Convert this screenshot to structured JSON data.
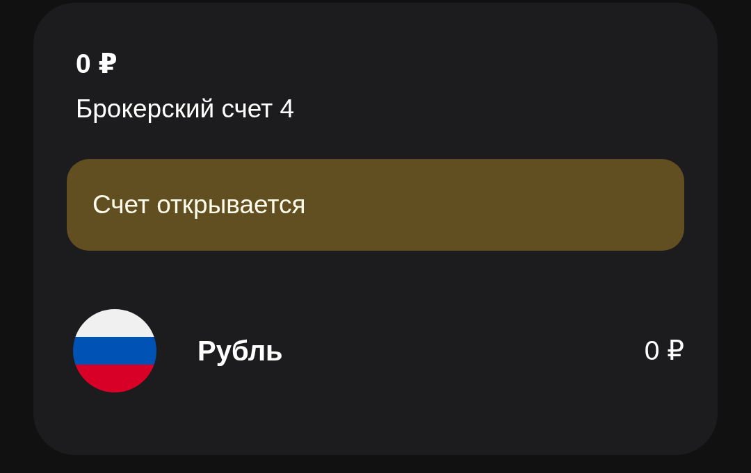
{
  "account": {
    "balance": "0 ₽",
    "name": "Брокерский счет 4"
  },
  "status_banner": {
    "text": "Счет открывается"
  },
  "currencies": [
    {
      "name": "Рубль",
      "amount": "0 ₽"
    }
  ]
}
